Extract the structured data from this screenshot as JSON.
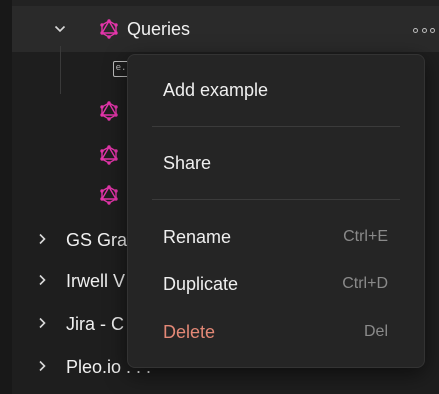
{
  "tree": {
    "queries_label": "Queries",
    "example_icon_text": "e.",
    "collections": [
      {
        "label": "GS Gra"
      },
      {
        "label": "Irwell V"
      },
      {
        "label": "Jira - C"
      },
      {
        "label": "Pleo.io . . ."
      }
    ],
    "icons": {
      "expand": "chevron-down-icon",
      "collapse": "chevron-right-icon",
      "graphql": "graphql-icon",
      "more": "more-options-icon",
      "example": "example-icon"
    }
  },
  "context_menu": {
    "add_example": "Add example",
    "share": "Share",
    "rename": "Rename",
    "rename_shortcut": "Ctrl+E",
    "duplicate": "Duplicate",
    "duplicate_shortcut": "Ctrl+D",
    "delete": "Delete",
    "delete_shortcut": "Del"
  },
  "colors": {
    "graphql_pink": "#e535ab",
    "danger": "#e38876",
    "background": "#1e1e1e",
    "menu_background": "#252525"
  }
}
